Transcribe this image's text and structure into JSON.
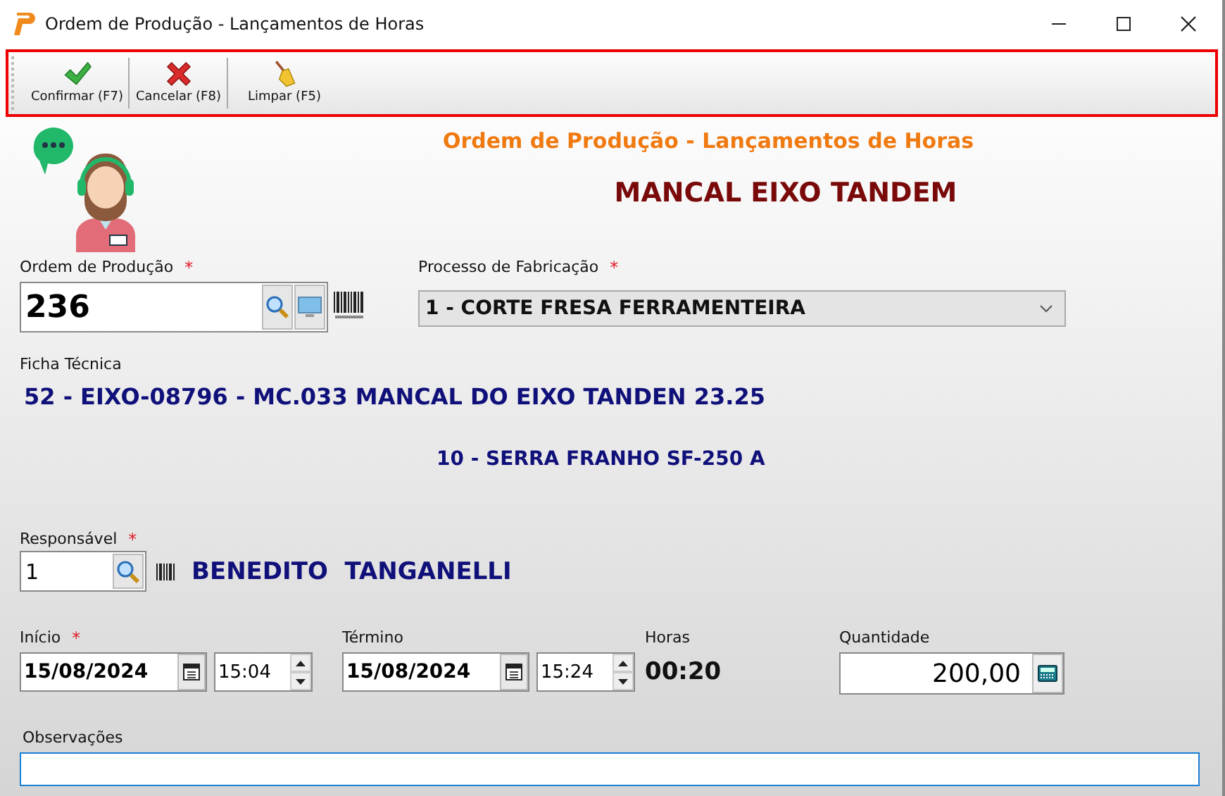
{
  "window": {
    "title": "Ordem de Produção - Lançamentos de Horas"
  },
  "toolbar": {
    "buttons": [
      {
        "kind": "confirm",
        "label": "Confirmar (F7)"
      },
      {
        "kind": "cancel",
        "label": "Cancelar (F8)"
      },
      {
        "kind": "clear",
        "label": "Limpar (F5)"
      }
    ]
  },
  "header": {
    "title": "Ordem de Produção - Lançamentos de Horas",
    "product": "MANCAL EIXO TANDEM"
  },
  "production_order": {
    "label": "Ordem de Produção",
    "required_mark": "*",
    "value": "236"
  },
  "process": {
    "label": "Processo de Fabricação",
    "required_mark": "*",
    "value": "1 - CORTE FRESA FERRAMENTEIRA"
  },
  "technical_sheet": {
    "label": "Ficha Técnica",
    "value": "52 - EIXO-08796 - MC.033 MANCAL DO EIXO TANDEN 23.25",
    "machine": "10 - SERRA FRANHO SF-250 A"
  },
  "responsible": {
    "label": "Responsável",
    "required_mark": "*",
    "value": "1",
    "name": "BENEDITO  TANGANELLI"
  },
  "start": {
    "label": "Início",
    "required_mark": "*",
    "date": "15/08/2024",
    "time": "15:04"
  },
  "end": {
    "label": "Término",
    "date": "15/08/2024",
    "time": "15:24"
  },
  "hours": {
    "label": "Horas",
    "value": "00:20"
  },
  "quantity": {
    "label": "Quantidade",
    "value": "200,00"
  },
  "notes": {
    "label": "Observações"
  }
}
